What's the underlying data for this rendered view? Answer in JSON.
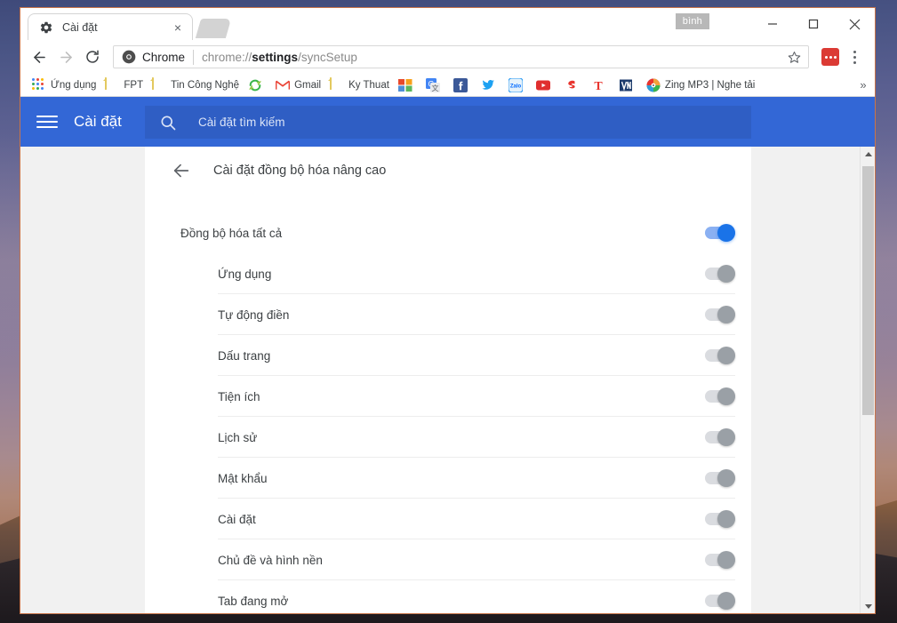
{
  "window": {
    "profile_chip": "bình",
    "minimize_label": "Thu nhỏ",
    "maximize_label": "Phóng to",
    "close_label": "Đóng"
  },
  "tab": {
    "favicon": "gear-icon",
    "title": "Cài đặt",
    "close_label": "×",
    "newtab_label": "Tab mới"
  },
  "toolbar": {
    "back_label": "Quay lại",
    "forward_label": "Tiến",
    "reload_label": "Tải lại",
    "omnibox": {
      "chip_icon": "chrome-icon",
      "chip_label": "Chrome",
      "url_prefix": "chrome://",
      "url_bold": "settings",
      "url_suffix": "/syncSetup"
    },
    "star_label": "Đánh dấu trang",
    "extension_label": "extension-icon",
    "menu_label": "Tùy chỉnh và kiểm soát Google Chrome"
  },
  "bookmarks": {
    "apps_icon": "apps-grid-icon",
    "apps_label": "Ứng dụng",
    "items": [
      {
        "label": "FPT",
        "icon": "folder-icon",
        "type": "folder"
      },
      {
        "label": "Tin Công Nghệ",
        "icon": "folder-icon",
        "type": "folder"
      },
      {
        "label": "",
        "icon": "sync-icon",
        "type": "site"
      },
      {
        "label": "Gmail",
        "icon": "gmail-icon",
        "type": "site"
      },
      {
        "label": "Ky Thuat",
        "icon": "folder-icon",
        "type": "folder"
      },
      {
        "label": "",
        "icon": "office-icon",
        "type": "site"
      },
      {
        "label": "",
        "icon": "google-translate-icon",
        "type": "site"
      },
      {
        "label": "",
        "icon": "facebook-icon",
        "type": "site"
      },
      {
        "label": "",
        "icon": "twitter-icon",
        "type": "site"
      },
      {
        "label": "",
        "icon": "zalo-icon",
        "type": "site"
      },
      {
        "label": "",
        "icon": "youtube-icon",
        "type": "site"
      },
      {
        "label": "",
        "icon": "sticker-icon",
        "type": "site"
      },
      {
        "label": "",
        "icon": "t-letter-icon",
        "type": "site"
      },
      {
        "label": "",
        "icon": "vn-letter-icon",
        "type": "site"
      },
      {
        "label": "Zing MP3 | Nghe tải",
        "icon": "zing-mp3-icon",
        "type": "site"
      }
    ],
    "overflow_label": "»"
  },
  "settings": {
    "menu_label": "menu-icon",
    "title": "Cài đặt",
    "search": {
      "icon": "search-icon",
      "placeholder": "Cài đặt tìm kiếm",
      "value": ""
    },
    "page": {
      "back_icon": "arrow-left-icon",
      "heading": "Cài đặt đồng bộ hóa nâng cao"
    },
    "master_row": {
      "label": "Đồng bộ hóa tất cả",
      "toggle_state": "on"
    },
    "rows": [
      {
        "label": "Ứng dụng",
        "toggle_state": "off"
      },
      {
        "label": "Tự động điền",
        "toggle_state": "off"
      },
      {
        "label": "Dấu trang",
        "toggle_state": "off"
      },
      {
        "label": "Tiện ích",
        "toggle_state": "off"
      },
      {
        "label": "Lịch sử",
        "toggle_state": "off"
      },
      {
        "label": "Mật khẩu",
        "toggle_state": "off"
      },
      {
        "label": "Cài đặt",
        "toggle_state": "off"
      },
      {
        "label": "Chủ đề và hình nền",
        "toggle_state": "off"
      },
      {
        "label": "Tab đang mở",
        "toggle_state": "off"
      }
    ],
    "scrollbar": {
      "up_label": "▲",
      "down_label": "▼"
    }
  },
  "colors": {
    "header_blue": "#3367d6",
    "search_blue": "#2f5ec4",
    "toggle_on": "#1a73e8",
    "toggle_on_track": "#8ab0f2",
    "toggle_off": "#9aa0a6",
    "toggle_off_track": "#dadce0",
    "page_bg": "#f1f1f1",
    "card_bg": "#ffffff",
    "text": "#3c4043",
    "extension_red": "#db3a34"
  }
}
